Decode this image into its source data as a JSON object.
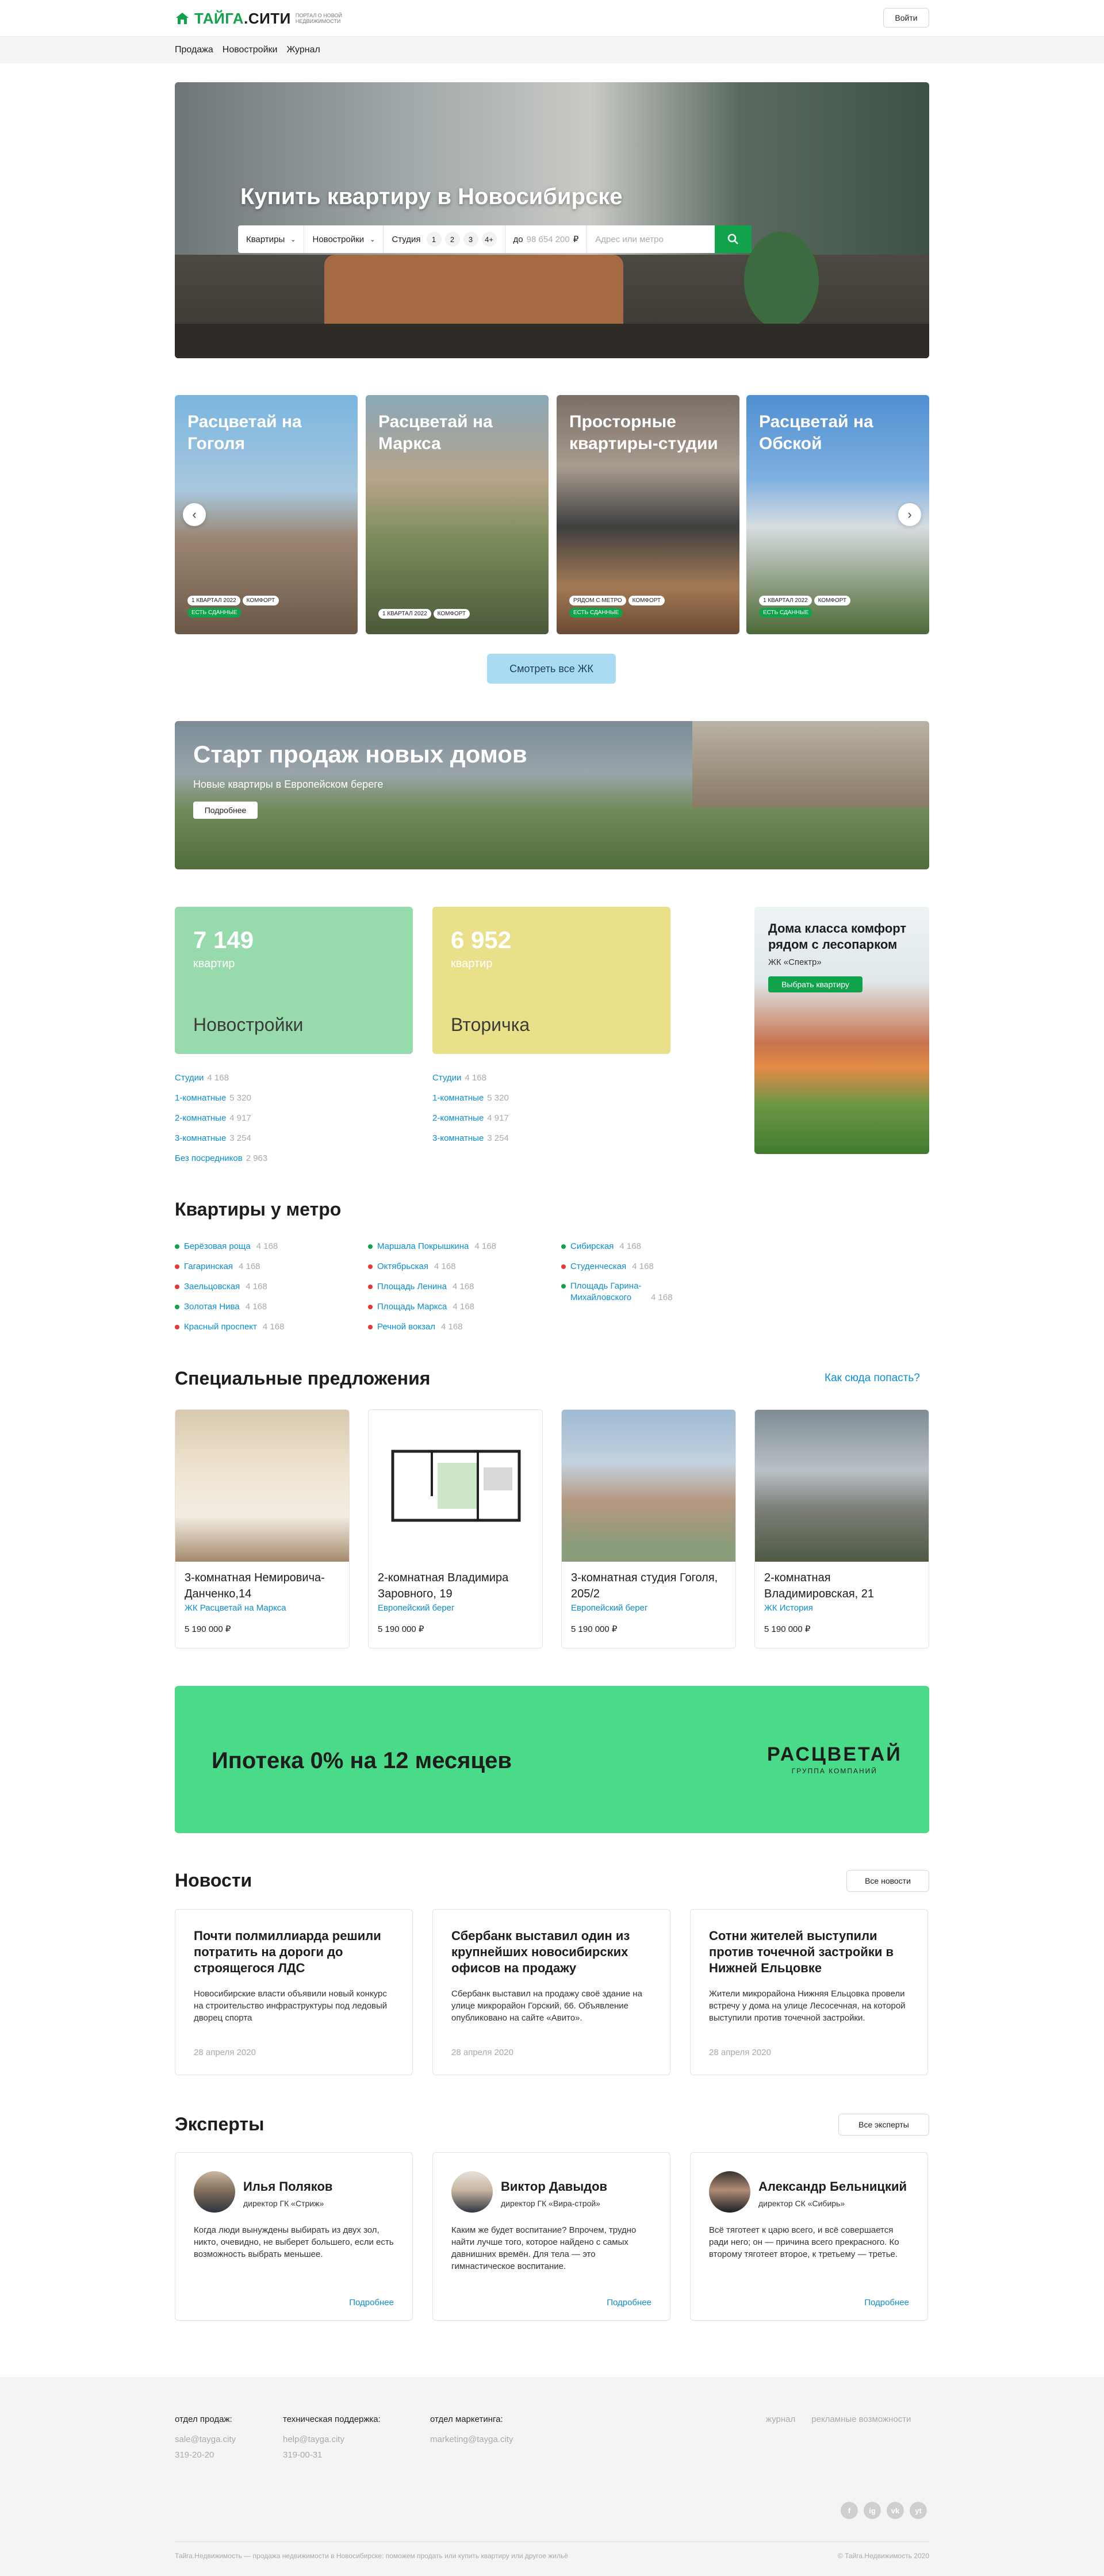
{
  "header": {
    "logo_main": "ТАЙГА",
    "logo_dot": ".СИТИ",
    "logo_sub": "ПОРТАЛ О НОВОЙ НЕДВИЖИМОСТИ",
    "login_label": "Войти"
  },
  "subnav": [
    "Продажа",
    "Новостройки",
    "Журнал"
  ],
  "hero": {
    "title": "Купить квартиру в Новосибирске",
    "search": {
      "type_value": "Квартиры",
      "kind_value": "Новостройки",
      "rooms_label": "Студия",
      "rooms": [
        "1",
        "2",
        "3",
        "4+"
      ],
      "price_prefix": "до",
      "price_placeholder": "98 654 200",
      "currency": "₽",
      "address_placeholder": "Адрес или метро"
    }
  },
  "complexes": [
    {
      "title": "Расцветай на Гоголя",
      "tags": [
        "1 КВАРТАЛ 2022",
        "КОМФОРТ"
      ],
      "tag2": "ЕСТЬ СДАННЫЕ"
    },
    {
      "title": "Расцветай на Маркса",
      "tags": [
        "1 КВАРТАЛ 2022",
        "КОМФОРТ"
      ],
      "tag2": ""
    },
    {
      "title": "Просторные квартиры-студии",
      "tags": [
        "РЯДОМ С МЕТРО",
        "КОМФОРТ"
      ],
      "tag2": "ЕСТЬ СДАННЫЕ"
    },
    {
      "title": "Расцветай на Обской",
      "tags": [
        "1 КВАРТАЛ 2022",
        "КОМФОРТ"
      ],
      "tag2": "ЕСТЬ СДАННЫЕ"
    }
  ],
  "see_all_label": "Смотреть все ЖК",
  "banner": {
    "title": "Старт продаж новых домов",
    "subtitle": "Новые квартиры в Европейском береге",
    "button": "Подробнее"
  },
  "stats": [
    {
      "count": "7 149",
      "unit": "квартир",
      "title": "Новостройки",
      "color": "#97dbad",
      "items": [
        {
          "label": "Студии",
          "count": "4 168"
        },
        {
          "label": "1-комнатные",
          "count": "5 320"
        },
        {
          "label": "2-комнатные",
          "count": "4 917"
        },
        {
          "label": "3-комнатные",
          "count": "3 254"
        },
        {
          "label": "Без посредников",
          "count": "2 963"
        }
      ]
    },
    {
      "count": "6 952",
      "unit": "квартир",
      "title": "Вторичка",
      "color": "#eae08a",
      "items": [
        {
          "label": "Студии",
          "count": "4 168"
        },
        {
          "label": "1-комнатные",
          "count": "5 320"
        },
        {
          "label": "2-комнатные",
          "count": "4 917"
        },
        {
          "label": "3-комнатные",
          "count": "3 254"
        }
      ]
    }
  ],
  "promo": {
    "title": "Дома класса комфорт рядом с лесопарком",
    "subtitle": "ЖК «Спектр»",
    "button": "Выбрать квартиру"
  },
  "metro": {
    "title": "Квартиры у метро",
    "columns": [
      [
        {
          "name": "Берёзовая роща",
          "count": "4 168",
          "color": "#11a34b"
        },
        {
          "name": "Гагаринская",
          "count": "4 168",
          "color": "#e53935"
        },
        {
          "name": "Заельцовская",
          "count": "4 168",
          "color": "#e53935"
        },
        {
          "name": "Золотая Нива",
          "count": "4 168",
          "color": "#11a34b"
        },
        {
          "name": "Красный проспект",
          "count": "4 168",
          "color": "#e53935"
        }
      ],
      [
        {
          "name": "Маршала Покрышкина",
          "count": "4 168",
          "color": "#11a34b"
        },
        {
          "name": "Октябрьская",
          "count": "4 168",
          "color": "#e53935"
        },
        {
          "name": "Площадь Ленина",
          "count": "4 168",
          "color": "#e53935"
        },
        {
          "name": "Площадь Маркса",
          "count": "4 168",
          "color": "#e53935"
        },
        {
          "name": "Речной вокзал",
          "count": "4 168",
          "color": "#e53935"
        }
      ],
      [
        {
          "name": "Сибирская",
          "count": "4 168",
          "color": "#11a34b"
        },
        {
          "name": "Студенческая",
          "count": "4 168",
          "color": "#e53935"
        },
        {
          "name": "Площадь Гарина-Михайловского",
          "count": "4 168",
          "color": "#11a34b"
        }
      ]
    ]
  },
  "offers": {
    "title": "Специальные предложения",
    "link": "Как сюда попасть?",
    "items": [
      {
        "title": "3-комнатная Немировича-Данченко,14",
        "complex": "ЖК Расцветай на Маркса",
        "price": "5 190 000 ₽"
      },
      {
        "title": "2-комнатная Владимира Заровного, 19",
        "complex": "Европейский берег",
        "price": "5 190 000 ₽"
      },
      {
        "title": "3-комнатная студия Гоголя, 205/2",
        "complex": "Европейский берег",
        "price": "5 190 000 ₽"
      },
      {
        "title": "2-комнатная Владимировская, 21",
        "complex": "ЖК История",
        "price": "5 190 000 ₽"
      }
    ]
  },
  "ipoteka": {
    "title": "Ипотека 0% на 12 месяцев",
    "logo": "РАСЦВЕТАЙ",
    "logo_sub": "ГРУППА КОМПАНИЙ"
  },
  "news": {
    "title": "Новости",
    "all": "Все новости",
    "items": [
      {
        "title": "Почти полмиллиарда решили потратить на дороги до строящегося ЛДС",
        "text": "Новосибирские власти объявили новый конкурс на строительство инфраструктуры под ледовый дворец спорта",
        "date": "28 апреля 2020"
      },
      {
        "title": "Сбербанк выставил один из крупнейших новосибирских офисов на продажу",
        "text": "Сбербанк выставил на продажу своё здание на улице микрорайон Горский, 66. Объявление опубликовано на сайте «Авито».",
        "date": "28 апреля 2020"
      },
      {
        "title": "Сотни жителей выступили против точечной застройки в Нижней Ельцовке",
        "text": "Жители микрорайона Нижняя Ельцовка провели встречу у дома на улице Лесосечная, на которой выступили против точечной застройки.",
        "date": "28 апреля 2020"
      }
    ]
  },
  "experts": {
    "title": "Эксперты",
    "all": "Все эксперты",
    "items": [
      {
        "name": "Илья Поляков",
        "role": "директор ГК «Стриж»",
        "text": "Когда люди вынуждены выбирать из двух зол, никто, очевидно, не выберет большего, если есть возможность выбрать меньшее.",
        "more": "Подробнее"
      },
      {
        "name": "Виктор Давыдов",
        "role": "директор ГК «Вира-строй»",
        "text": "Каким же будет воспитание? Впрочем, трудно найти лучше того, которое найдено с самых давнишних времён. Для тела — это гимнастическое воспитание.",
        "more": "Подробнее"
      },
      {
        "name": "Александр Бельницкий",
        "role": "директор СК «Сибирь»",
        "text": "Всё тяготеет к царю всего, и всё совершается ради него; он — причина всего прекрасного. Ко второму тяготеет второе, к третьему — третье.",
        "more": "Подробнее"
      }
    ]
  },
  "footer": {
    "sales_label": "отдел продаж:",
    "sales_email": "sale@tayga.city",
    "sales_phone": "319-20-20",
    "support_label": "техническая поддержка:",
    "support_email": "help@tayga.city",
    "support_phone": "319-00-31",
    "marketing_label": "отдел маркетинга:",
    "marketing_email": "marketing@tayga.city",
    "link_journal": "журнал",
    "link_ads": "рекламные возможности",
    "bottom_text": "Тайга.Недвижимость — продажа недвижимости в Новосибирске: поможем продать или купить квартиру или другое жильё",
    "copyright": "© Тайга.Недвижимость 2020",
    "socials": [
      "f",
      "ig",
      "vk",
      "yt"
    ]
  }
}
